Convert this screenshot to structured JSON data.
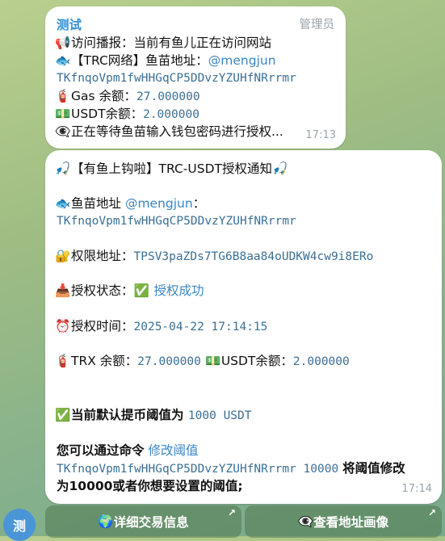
{
  "message1": {
    "sender": "测试",
    "role": "管理员",
    "line1_icon": "📢",
    "line1_text": "访问播报：当前有鱼儿正在访问网站",
    "line2_icon": "🐟",
    "line2_text": "【TRC网络】鱼苗地址：",
    "line2_mention": "@mengjun",
    "address": "TKfnqoVpm1fwHHGqCP5DDvzYZUHfNRrrmr",
    "gas_icon": "🧯",
    "gas_label": "Gas 余额：",
    "gas_value": "27.000000",
    "usdt_icon": "💵",
    "usdt_label": "USDT余额：",
    "usdt_value": "2.000000",
    "wait_icon": "👁️‍🗨️",
    "wait_text": "正在等待鱼苗输入钱包密码进行授权...",
    "time": "17:13"
  },
  "message2": {
    "title_icon": "🎣",
    "title_text": "【有鱼上钩啦】TRC-USDT授权通知",
    "title_icon_end": "🎣",
    "fish_icon": "🐟",
    "fish_label": "鱼苗地址",
    "fish_mention": "@mengjun",
    "fish_colon": "：",
    "address": "TKfnqoVpm1fwHHGqCP5DDvzYZUHfNRrrmr",
    "perm_icon": "🔐",
    "perm_label": "权限地址：",
    "perm_value": "TPSV3paZDs7TG6B8aa84oUDKW4cw9i8ERo",
    "status_icon": "📥",
    "status_label": "授权状态：",
    "status_check": "✅",
    "status_value": "授权成功",
    "time_icon": "⏰",
    "time_label": "授权时间：",
    "time_value": "2025-04-22 17:14:15",
    "trx_icon": "🧯",
    "trx_label": "TRX 余额：",
    "trx_value": "27.000000",
    "usdt_icon": "💵",
    "usdt_label": "USDT余额：",
    "usdt_value": "2.000000",
    "threshold_check": "✅",
    "threshold_text": "当前默认提币阈值为",
    "threshold_value": "1000 USDT",
    "cmd_text": "您可以通过命令",
    "cmd_link": "修改阈值",
    "cmd_code": "TKfnqoVpm1fwHHGqCP5DDvzYZUHfNRrrmr 10000",
    "cmd_tail": "将阈值修改",
    "cmd_tail2": "为10000或者你想要设置的阈值;",
    "time": "17:14"
  },
  "avatar_letter": "测",
  "buttons": {
    "detail_icon": "🌍",
    "detail_label": "详细交易信息",
    "profile_icon": "👁️‍🗨️",
    "profile_label": "查看地址画像",
    "arrow": "↗"
  }
}
